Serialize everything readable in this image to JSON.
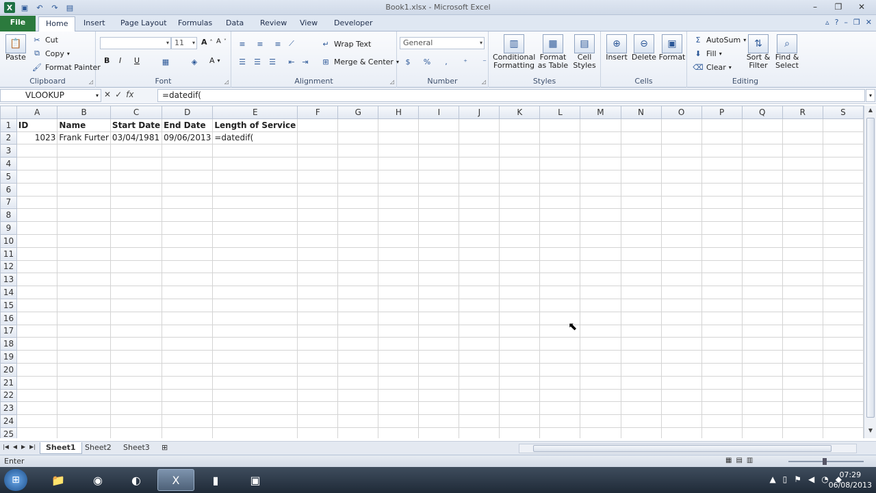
{
  "window": {
    "title": "Book1.xlsx - Microsoft Excel",
    "icons": [
      "excel-icon",
      "save-icon",
      "undo-icon",
      "redo-icon",
      "new-icon"
    ]
  },
  "tabs": [
    "File",
    "Home",
    "Insert",
    "Page Layout",
    "Formulas",
    "Data",
    "Review",
    "View",
    "Developer"
  ],
  "ribbon": {
    "clipboard": {
      "label": "Clipboard",
      "paste": "Paste",
      "cut": "Cut",
      "copy": "Copy",
      "format_painter": "Format Painter"
    },
    "font": {
      "label": "Font",
      "size": "11",
      "bold": "B",
      "italic": "I",
      "underline": "U",
      "grow": "A",
      "shrink": "A",
      "color": "A"
    },
    "alignment": {
      "label": "Alignment",
      "wrap": "Wrap Text",
      "merge": "Merge & Center"
    },
    "number": {
      "label": "Number",
      "format": "General",
      "currency": "$",
      "percent": "%",
      "comma": ","
    },
    "styles": {
      "label": "Styles",
      "cond1": "Conditional",
      "cond2": "Formatting",
      "fmt1": "Format",
      "fmt2": "as Table",
      "cell1": "Cell",
      "cell2": "Styles"
    },
    "cells": {
      "label": "Cells",
      "insert": "Insert",
      "delete": "Delete",
      "format": "Format"
    },
    "editing": {
      "label": "Editing",
      "autosum": "AutoSum",
      "fill": "Fill",
      "clear": "Clear",
      "sort1": "Sort &",
      "sort2": "Filter",
      "find1": "Find &",
      "find2": "Select"
    }
  },
  "formula_bar": {
    "name_box": "VLOOKUP",
    "formula": "=datedif("
  },
  "sheet": {
    "columns": [
      "A",
      "B",
      "C",
      "D",
      "E",
      "F",
      "G",
      "H",
      "I",
      "J",
      "K",
      "L",
      "M",
      "N",
      "O",
      "P",
      "Q",
      "R",
      "S"
    ],
    "rows": 25,
    "cells": {
      "1": [
        "ID",
        "Name",
        "Start Date",
        "End Date",
        "Length of Service"
      ],
      "2": [
        "1023",
        "Frank Furter",
        "03/04/1981",
        "09/06/2013",
        "=datedif("
      ]
    }
  },
  "sheet_tabs": [
    "Sheet1",
    "Sheet2",
    "Sheet3"
  ],
  "status": {
    "mode": "Enter"
  },
  "taskbar": {
    "time": "07:29",
    "date": "06/08/2013"
  }
}
